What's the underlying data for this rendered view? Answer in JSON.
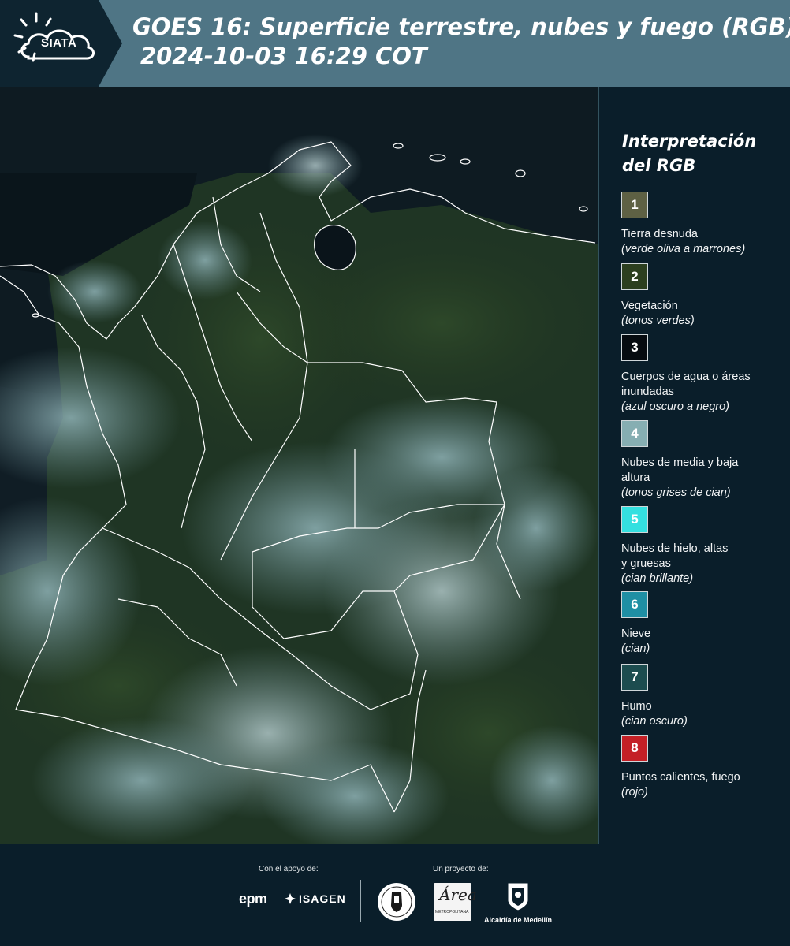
{
  "header": {
    "logo_text": "SIATA",
    "title_line1": "GOES 16: Superficie terrestre, nubes y fuego (RGB)",
    "title_line2": "2024-10-03 16:29 COT"
  },
  "legend": {
    "title_line1": "Interpretación",
    "title_line2": "del RGB",
    "items": [
      {
        "num": "1",
        "color": "#5e6144",
        "text_color": "#ffffff",
        "label": "Tierra desnuda",
        "note": "(verde oliva a marrones)"
      },
      {
        "num": "2",
        "color": "#2c3f1f",
        "text_color": "#ffffff",
        "label": "Vegetación",
        "note": "(tonos verdes)"
      },
      {
        "num": "3",
        "color": "#060b10",
        "text_color": "#ffffff",
        "label": "Cuerpos de agua o áreas inundadas",
        "note": "(azul oscuro a negro)"
      },
      {
        "num": "4",
        "color": "#86aeb2",
        "text_color": "#ffffff",
        "label": "Nubes de media y baja altura",
        "note": "(tonos grises de cian)"
      },
      {
        "num": "5",
        "color": "#34e0e0",
        "text_color": "#ffffff",
        "label": "Nubes de hielo, altas y gruesas",
        "note": "(cian brillante)"
      },
      {
        "num": "6",
        "color": "#1f8fa4",
        "text_color": "#ffffff",
        "label": "Nieve",
        "note": "(cian)"
      },
      {
        "num": "7",
        "color": "#1c4c4f",
        "text_color": "#ffffff",
        "label": "Humo",
        "note": "(cian oscuro)"
      },
      {
        "num": "8",
        "color": "#c42026",
        "text_color": "#ffffff",
        "label": "Puntos calientes, fuego",
        "note": "(rojo)"
      }
    ]
  },
  "footer": {
    "support_label": "Con el apoyo de:",
    "project_label": "Un proyecto de:",
    "epm": "epm",
    "isagen": "ISAGEN",
    "area_big": "Área",
    "area_small": "METROPOLITANA",
    "alcaldia": "Alcaldía de Medellín"
  }
}
